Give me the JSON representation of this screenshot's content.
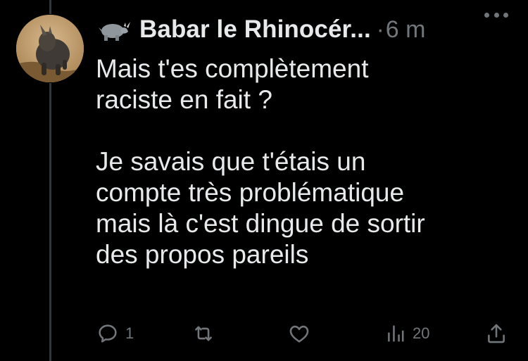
{
  "tweet": {
    "author_emoji_icon": "rhinoceros-emoji",
    "author_name": "Babar le Rhinocér...",
    "separator": "·",
    "time": "6 m",
    "text_lines_1": [
      "Mais t'es complètement",
      "raciste en fait ?"
    ],
    "text_lines_2": [
      "Je savais que t'étais un",
      "compte très problématique",
      "mais là c'est dingue de sortir",
      "des propos pareils"
    ]
  },
  "actions": {
    "reply_icon": "speech-bubble-icon",
    "reply_count": "1",
    "retweet_icon": "retweet-icon",
    "like_icon": "heart-icon",
    "views_icon": "bar-chart-icon",
    "views_count": "20",
    "share_icon": "share-upload-icon"
  },
  "colors": {
    "background": "#000000",
    "text": "#e7e9ea",
    "muted": "#71767b",
    "thread_line": "#333639"
  }
}
